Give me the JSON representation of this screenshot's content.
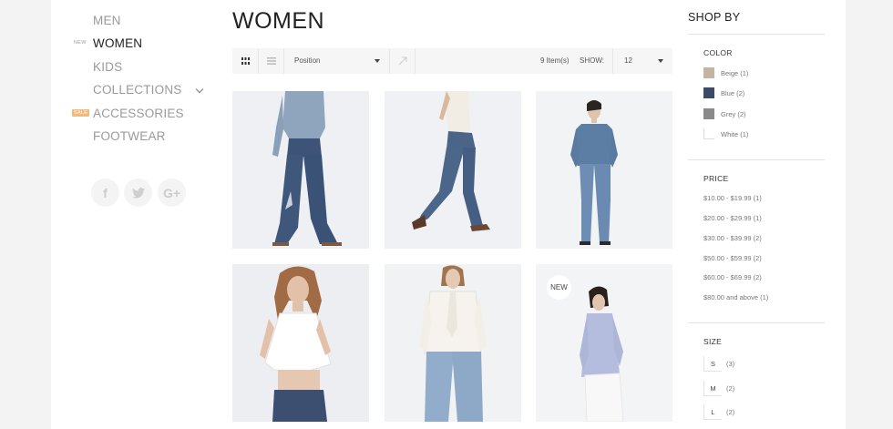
{
  "nav": {
    "items": [
      {
        "label": "MEN"
      },
      {
        "label": "WOMEN",
        "tag": "NEW"
      },
      {
        "label": "KIDS"
      },
      {
        "label": "COLLECTIONS"
      },
      {
        "label": "ACCESSORIES",
        "tag": "SALE"
      },
      {
        "label": "FOOTWEAR"
      }
    ],
    "social": [
      "f",
      "t",
      "G+"
    ]
  },
  "main": {
    "title": "WOMEN",
    "toolbar": {
      "sort_value": "Position",
      "items_count": "9 Item(s)",
      "show_label": "SHOW:",
      "show_value": "12"
    },
    "products": [
      {
        "name": "product-1",
        "badge": ""
      },
      {
        "name": "product-2",
        "badge": ""
      },
      {
        "name": "product-3",
        "badge": ""
      },
      {
        "name": "product-4",
        "badge": ""
      },
      {
        "name": "product-5",
        "badge": ""
      },
      {
        "name": "product-6",
        "badge": "NEW"
      }
    ]
  },
  "shop_by": {
    "title": "SHOP BY",
    "color": {
      "title": "COLOR",
      "options": [
        {
          "label": "Beige (1)",
          "hex": "#c4b5a3"
        },
        {
          "label": "Blue (2)",
          "hex": "#3d4a66"
        },
        {
          "label": "Grey (2)",
          "hex": "#8a8a8a"
        },
        {
          "label": "White (1)",
          "hex": "#ffffff"
        }
      ]
    },
    "price": {
      "title": "PRICE",
      "options": [
        "$10.00 - $19.99 (1)",
        "$20.00 - $29.99 (1)",
        "$30.00 - $39.99 (2)",
        "$50.00 - $59.99 (2)",
        "$60.00 - $69.99 (2)",
        "$80.00 and above (1)"
      ]
    },
    "size": {
      "title": "SIZE",
      "options": [
        {
          "label": "S",
          "count": "(3)"
        },
        {
          "label": "M",
          "count": "(2)"
        },
        {
          "label": "L",
          "count": "(2)"
        }
      ]
    }
  }
}
